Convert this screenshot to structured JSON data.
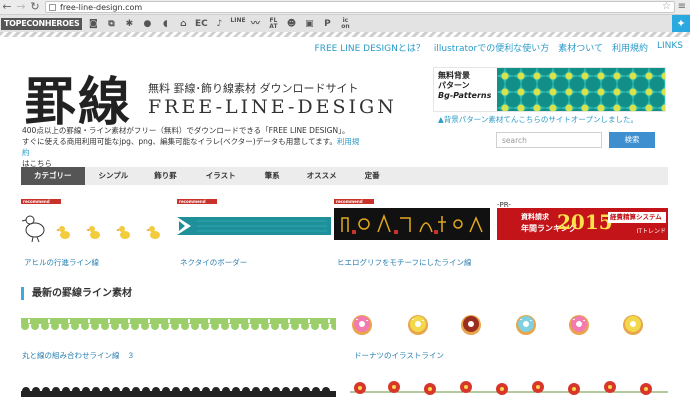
{
  "browser": {
    "url": "free-line-design.com"
  },
  "toolbar": {
    "brand": "TOPECONHEROES",
    "icons": [
      "camera-icon",
      "copy-icon",
      "badge-icon",
      "bubble-icon",
      "bubble-icon",
      "home-icon",
      "ec-icon",
      "note-icon",
      "line-icon",
      "wave-icon",
      "flat-icon",
      "smile-icon",
      "book-icon",
      "p-icon",
      "icon-icon"
    ],
    "labels": {
      "ec": "EC",
      "line": "LINE",
      "flat_top": "FL",
      "flat_bottom": "AT",
      "p": "P",
      "icon_top": "ic",
      "icon_bottom": "on"
    }
  },
  "top_links": [
    {
      "label": "FREE LINE DESIGNとは？",
      "name": "about"
    },
    {
      "label": "illustratorでの便利な使い方",
      "name": "howto"
    },
    {
      "label": "素材ついて",
      "name": "materials"
    },
    {
      "label": "利用規約",
      "name": "terms"
    },
    {
      "label": "LINKS",
      "name": "links"
    }
  ],
  "logo": {
    "kanji": "罫線",
    "subtitle": "無料 罫線･飾り線素材 ダウンロードサイト",
    "english": "FREE-LINE-DESIGN"
  },
  "banner": {
    "line1": "無料背景",
    "line2": "パターン",
    "line3": "Bg-Patterns",
    "caption": "▲背景パターン素材てんこちらのサイトオープンしました。"
  },
  "intro": {
    "line1": "400点以上の罫線・ライン素材がフリー（無料）でダウンロードできる「FREE LINE DESIGN」。",
    "line2": "すぐに使える商用利用可能なjpg、png、編集可能なイラレ(ベクター)データも用意してます。",
    "link": "利用規約",
    "line3": "はこちら"
  },
  "search": {
    "placeholder": "search",
    "button": "検索"
  },
  "nav": {
    "items": [
      "カテゴリー",
      "シンプル",
      "飾り罫",
      "イラスト",
      "筆系",
      "オススメ",
      "定番"
    ],
    "active_index": 0
  },
  "cards": [
    {
      "badge": "recommend",
      "title": "アヒルの行進ライン線"
    },
    {
      "badge": "recommend",
      "title": "ネクタイのボーダー"
    },
    {
      "badge": "recommend",
      "title": "ヒエログリフをモチーフにしたライン線"
    }
  ],
  "ad": {
    "pr_label": "-PR-",
    "line1": "資料請求",
    "line2": "年間ランキング",
    "year": "2015",
    "line3": "経費精算システム部門",
    "line4": "ITトレンド"
  },
  "section": {
    "title": "最新の罫線ライン素材"
  },
  "latest": [
    {
      "title": "丸と線の組み合わせライン線　３"
    },
    {
      "title": "ドーナツのイラストライン"
    }
  ],
  "colors": {
    "link": "#2a9bc8",
    "accent_blue": "#3aaae0",
    "nav_active": "#555555",
    "recommend_red": "#c8322a",
    "ad_red": "#c3141a",
    "tie_teal": "#1f8f9a",
    "green_line": "#9ccf6b"
  }
}
